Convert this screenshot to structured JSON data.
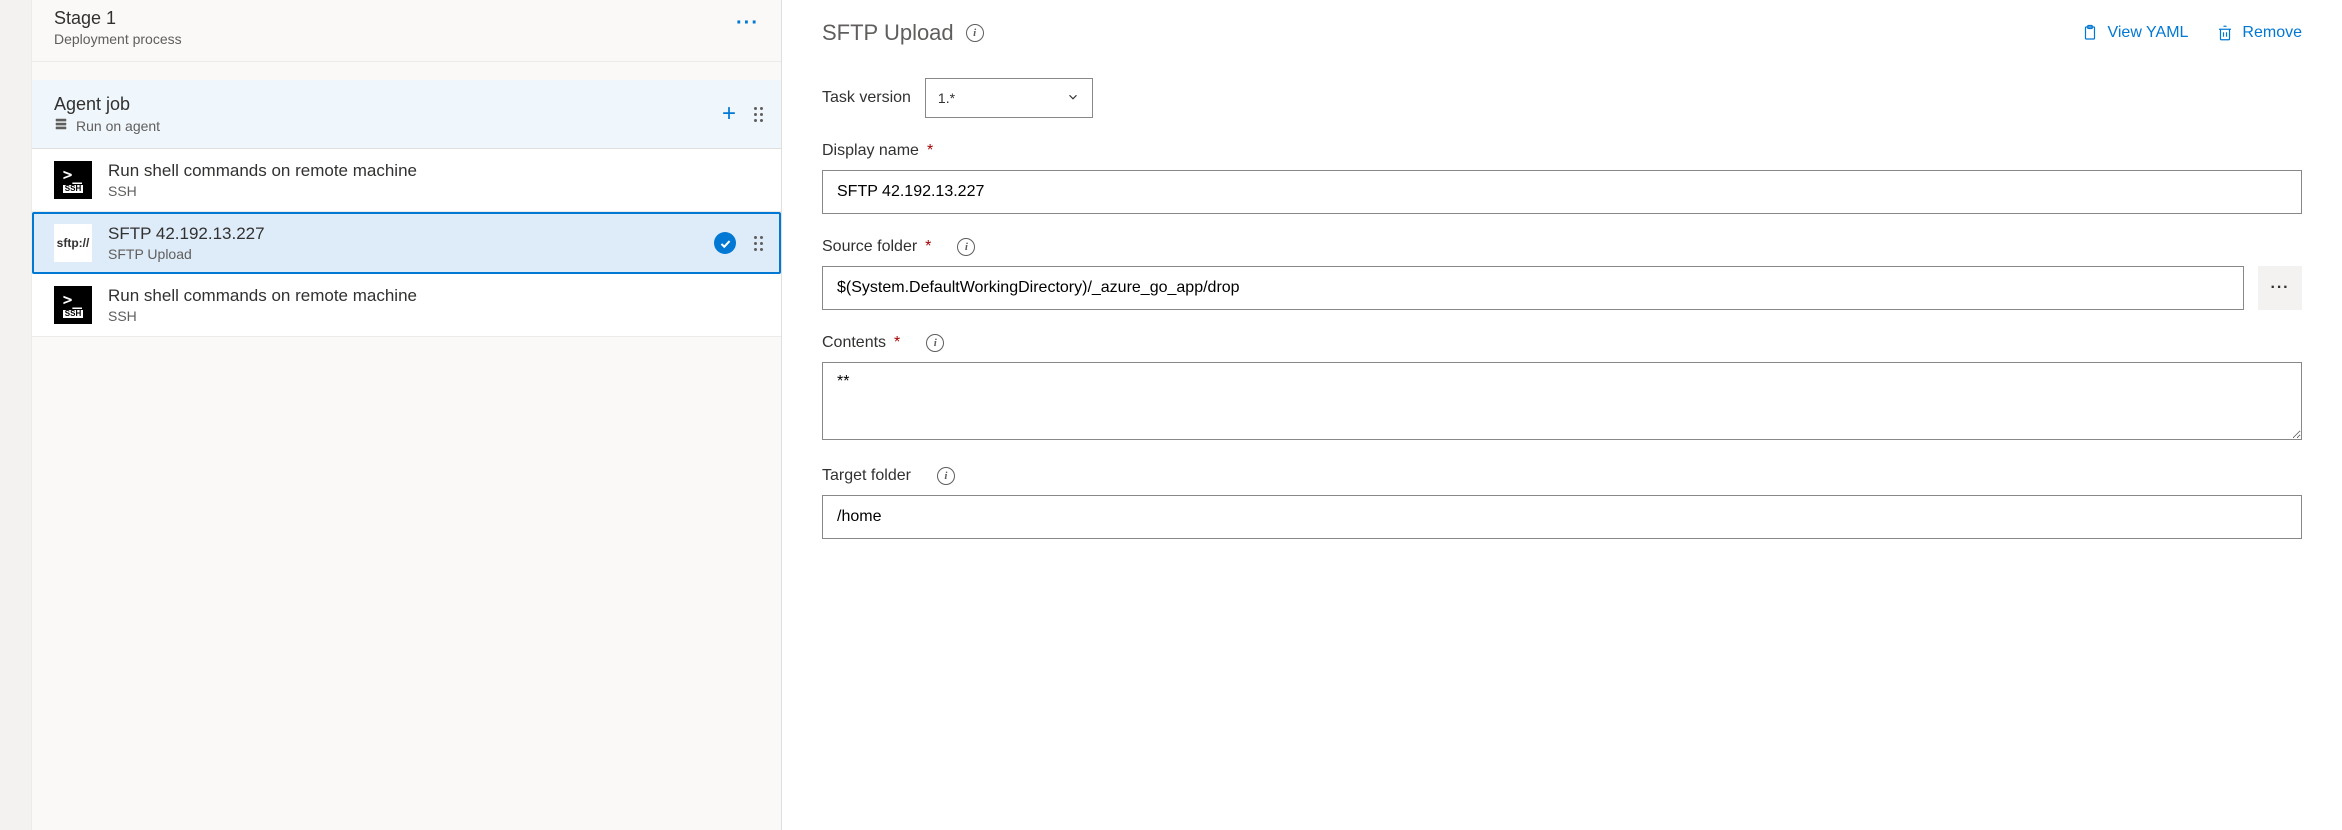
{
  "stage": {
    "title": "Stage 1",
    "subtitle": "Deployment process"
  },
  "agentJob": {
    "title": "Agent job",
    "subtitle": "Run on agent"
  },
  "tasks": [
    {
      "iconType": "ssh",
      "iconText": "SSH",
      "title": "Run shell commands on remote machine",
      "subtitle": "SSH",
      "selected": false,
      "completed": false
    },
    {
      "iconType": "sftp",
      "iconText": "sftp://",
      "title": "SFTP 42.192.13.227",
      "subtitle": "SFTP Upload",
      "selected": true,
      "completed": true
    },
    {
      "iconType": "ssh",
      "iconText": "SSH",
      "title": "Run shell commands on remote machine",
      "subtitle": "SSH",
      "selected": false,
      "completed": false
    }
  ],
  "detail": {
    "heading": "SFTP Upload",
    "viewYaml": "View YAML",
    "remove": "Remove",
    "taskVersionLabel": "Task version",
    "taskVersionValue": "1.*",
    "displayNameLabel": "Display name",
    "displayNameValue": "SFTP 42.192.13.227",
    "sourceFolderLabel": "Source folder",
    "sourceFolderValue": "$(System.DefaultWorkingDirectory)/_azure_go_app/drop",
    "contentsLabel": "Contents",
    "contentsValue": "**",
    "targetFolderLabel": "Target folder",
    "targetFolderValue": "/home"
  }
}
